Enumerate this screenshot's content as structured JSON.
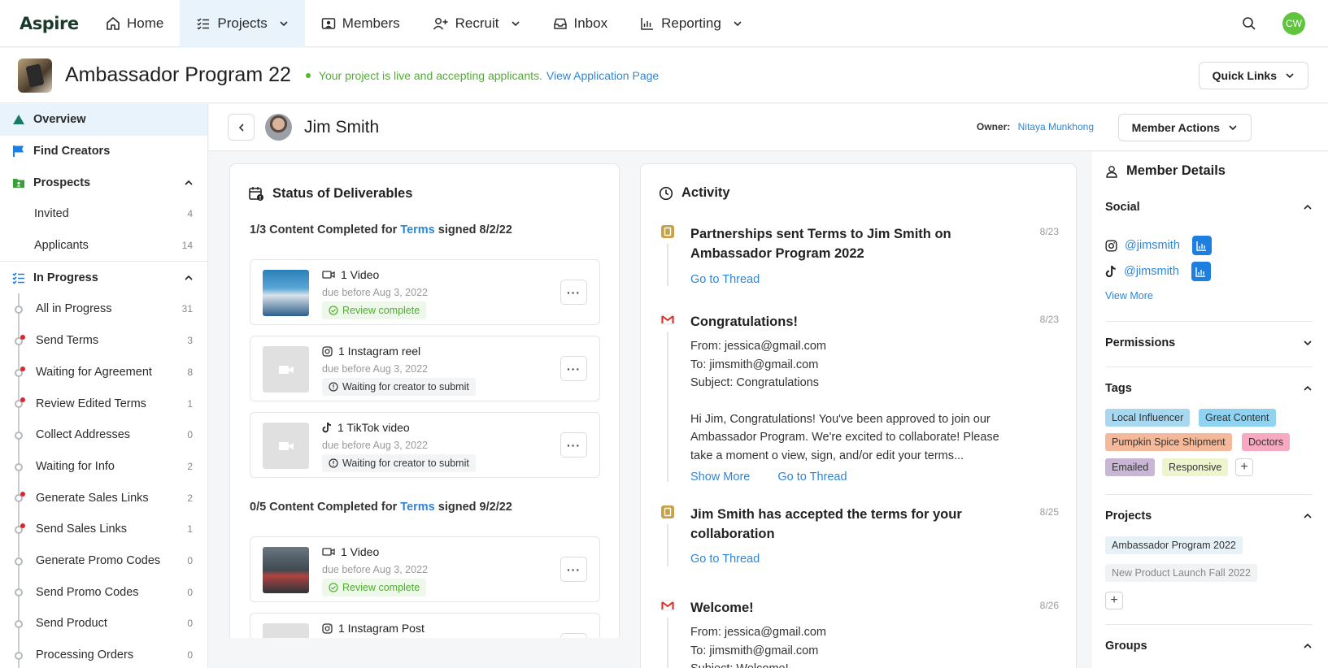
{
  "nav": {
    "logo": "Aspire",
    "items": [
      {
        "label": "Home"
      },
      {
        "label": "Projects"
      },
      {
        "label": "Members"
      },
      {
        "label": "Recruit"
      },
      {
        "label": "Inbox"
      },
      {
        "label": "Reporting"
      }
    ],
    "avatar_initials": "CW"
  },
  "project": {
    "title": "Ambassador Program 22",
    "status_text": "Your project is live and accepting applicants.",
    "status_link": "View Application Page",
    "quick_links": "Quick Links"
  },
  "sidebar": {
    "overview": "Overview",
    "find_creators": "Find Creators",
    "prospects": "Prospects",
    "prospects_items": [
      {
        "label": "Invited",
        "count": "4"
      },
      {
        "label": "Applicants",
        "count": "14"
      }
    ],
    "in_progress": "In Progress",
    "steps": [
      {
        "label": "All in Progress",
        "count": "31",
        "alert": false
      },
      {
        "label": "Send Terms",
        "count": "3",
        "alert": true
      },
      {
        "label": "Waiting for Agreement",
        "count": "8",
        "alert": true
      },
      {
        "label": "Review Edited Terms",
        "count": "1",
        "alert": true
      },
      {
        "label": "Collect Addresses",
        "count": "0",
        "alert": false
      },
      {
        "label": "Waiting for Info",
        "count": "2",
        "alert": false
      },
      {
        "label": "Generate Sales Links",
        "count": "2",
        "alert": true
      },
      {
        "label": "Send Sales Links",
        "count": "1",
        "alert": true
      },
      {
        "label": "Generate Promo Codes",
        "count": "0",
        "alert": false
      },
      {
        "label": "Send Promo Codes",
        "count": "0",
        "alert": false
      },
      {
        "label": "Send Product",
        "count": "0",
        "alert": false
      },
      {
        "label": "Processing Orders",
        "count": "0",
        "alert": false
      }
    ]
  },
  "member": {
    "name": "Jim Smith",
    "owner_label": "Owner:",
    "owner_name": "Nitaya Munkhong",
    "actions": "Member Actions"
  },
  "deliverables": {
    "title": "Status of Deliverables",
    "groups": [
      {
        "prefix": "1/3 Content Completed for",
        "link": "Terms",
        "suffix": "signed 8/2/22"
      },
      {
        "prefix": "0/5 Content Completed for",
        "link": "Terms",
        "suffix": "signed 9/2/22"
      }
    ],
    "items": [
      {
        "type": "1 Video",
        "due": "due before Aug 3, 2022",
        "status": "Review complete"
      },
      {
        "type": "1 Instagram reel",
        "due": "due before Aug 3, 2022",
        "status": "Waiting for creator to submit"
      },
      {
        "type": "1 TikTok video",
        "due": "due before Aug 3, 2022",
        "status": "Waiting for creator to submit"
      },
      {
        "type": "1 Video",
        "due": "due before Aug 3, 2022",
        "status": "Review complete"
      },
      {
        "type": "1 Instagram Post",
        "due": "",
        "status": ""
      }
    ],
    "more": "···"
  },
  "activity": {
    "title": "Activity",
    "items": [
      {
        "title_l1": "Partnerships sent Terms to Jim Smith on",
        "title_l2": "Ambassador Program 2022",
        "date": "8/23",
        "link": "Go to Thread"
      },
      {
        "title_l1": "Congratulations!",
        "date": "8/23",
        "from": "From: jessica@gmail.com",
        "to": "To: jimsmith@gmail.com",
        "subject": "Subject: Congratulations",
        "body_l1": "Hi Jim, Congratulations! You've been approved to join our",
        "body_l2": "Ambassador Program. We're excited to collaborate! Please",
        "body_l3": "take a moment o view, sign, and/or edit your terms...",
        "show_more": "Show More",
        "link": "Go to Thread"
      },
      {
        "title_l1": "Jim Smith has accepted the terms for your",
        "title_l2": "collaboration",
        "date": "8/25",
        "link": "Go to Thread"
      },
      {
        "title_l1": "Welcome!",
        "date": "8/26",
        "from": "From: jessica@gmail.com",
        "to": "To: jimsmith@gmail.com",
        "subject": "Subject: Welcome!"
      }
    ]
  },
  "details": {
    "title": "Member Details",
    "social": "Social",
    "instagram_handle": "@jimsmith",
    "tiktok_handle": "@jimsmith",
    "view_more": "View More",
    "permissions": "Permissions",
    "tags_title": "Tags",
    "tags": [
      {
        "label": "Local Influencer",
        "color": "#a8d8f0"
      },
      {
        "label": "Great Content",
        "color": "#8fd3f0"
      },
      {
        "label": "Pumpkin Spice Shipment",
        "color": "#f3b99a"
      },
      {
        "label": "Doctors",
        "color": "#f6a9c0"
      },
      {
        "label": "Emailed",
        "color": "#c9b6d6"
      },
      {
        "label": "Responsive",
        "color": "#eef5cc"
      }
    ],
    "projects_title": "Projects",
    "projects": [
      "Ambassador Program 2022",
      "New Product Launch Fall 2022"
    ],
    "groups_title": "Groups"
  }
}
